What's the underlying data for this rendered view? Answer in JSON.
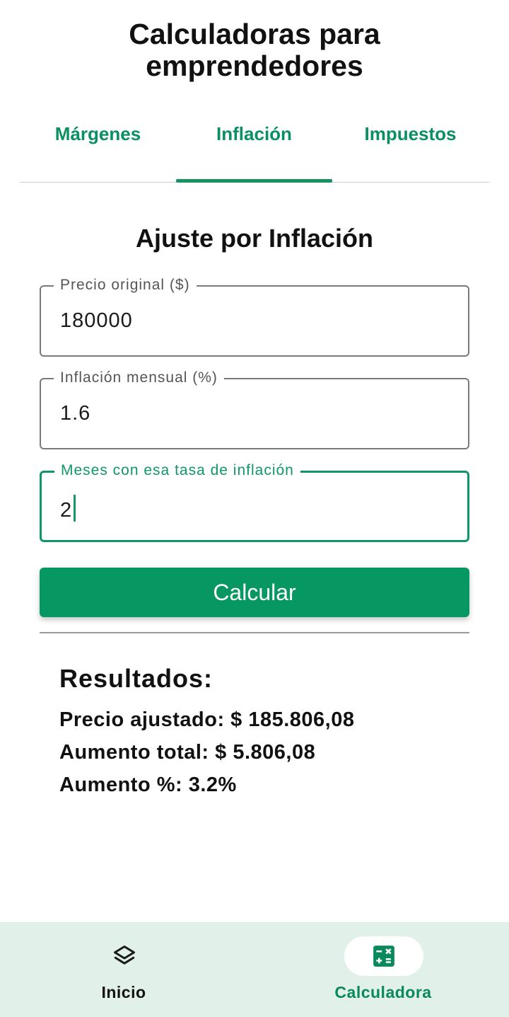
{
  "app": {
    "title_line1": "Calculadoras para",
    "title_line2": "emprendedores"
  },
  "tabs": [
    {
      "label": "Márgenes",
      "selected": false
    },
    {
      "label": "Inflación",
      "selected": true
    },
    {
      "label": "Impuestos",
      "selected": false
    }
  ],
  "section": {
    "title": "Ajuste por Inflación"
  },
  "form": {
    "price": {
      "label": "Precio original ($)",
      "value": "180000"
    },
    "inflation": {
      "label": "Inflación mensual (%)",
      "value": "1.6"
    },
    "months": {
      "label": "Meses con esa tasa de inflación",
      "value": "2",
      "focused": true
    }
  },
  "button": {
    "calculate_label": "Calcular"
  },
  "results": {
    "heading": "Resultados:",
    "adjusted_price": "Precio ajustado: $ 185.806,08",
    "total_increase": "Aumento total: $ 5.806,08",
    "percent_increase": "Aumento %: 3.2%"
  },
  "bottom_nav": {
    "items": [
      {
        "label": "Inicio",
        "icon": "layers-icon",
        "selected": false
      },
      {
        "label": "Calculadora",
        "icon": "calculator-icon",
        "selected": true
      }
    ]
  },
  "colors": {
    "accent": "#079762",
    "tab_text": "#0a9061",
    "nav_background": "#e1f1ea"
  }
}
